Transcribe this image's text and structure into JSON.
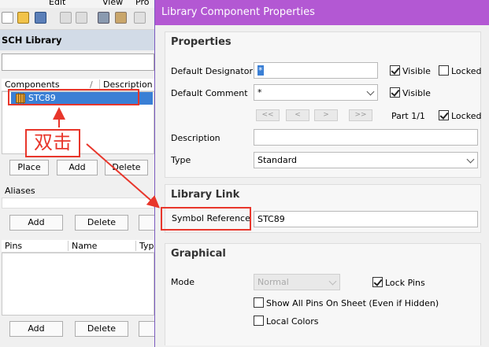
{
  "menu": {
    "items": [
      "Edit",
      "View",
      "Pro"
    ]
  },
  "sch_library": {
    "title": "SCH Library",
    "components_header": "Components",
    "sort_glyph": "/",
    "description_header": "Description",
    "component_name": "STC89",
    "buttons": {
      "place": "Place",
      "add": "Add",
      "delete": "Delete"
    }
  },
  "aliases": {
    "header": "Aliases",
    "add": "Add",
    "delete": "Delete"
  },
  "pins": {
    "header": "Pins",
    "name": "Name",
    "type": "Type",
    "add": "Add",
    "delete": "Delete"
  },
  "annotation": {
    "text": "双击"
  },
  "dialog": {
    "title": "Library Component Properties",
    "properties": {
      "title": "Properties",
      "designator_label": "Default Designator",
      "designator_value": "*",
      "comment_label": "Default Comment",
      "comment_value": "*",
      "visible_label": "Visible",
      "locked_label": "Locked",
      "nav": [
        "<<",
        "<",
        ">",
        ">>"
      ],
      "part_label": "Part 1/1",
      "description_label": "Description",
      "description_value": "",
      "type_label": "Type",
      "type_value": "Standard"
    },
    "library_link": {
      "title": "Library Link",
      "symbol_label": "Symbol Reference",
      "symbol_value": "STC89"
    },
    "graphical": {
      "title": "Graphical",
      "mode_label": "Mode",
      "mode_value": "Normal",
      "lock_pins_label": "Lock Pins",
      "show_all_pins_label": "Show All Pins On Sheet (Even if Hidden)",
      "local_colors_label": "Local Colors"
    }
  },
  "colors": {
    "titlebar": "#b358d3",
    "selection": "#3a7fd5",
    "annotation": "#e8362b",
    "sch_header": "#d2dbe7"
  }
}
